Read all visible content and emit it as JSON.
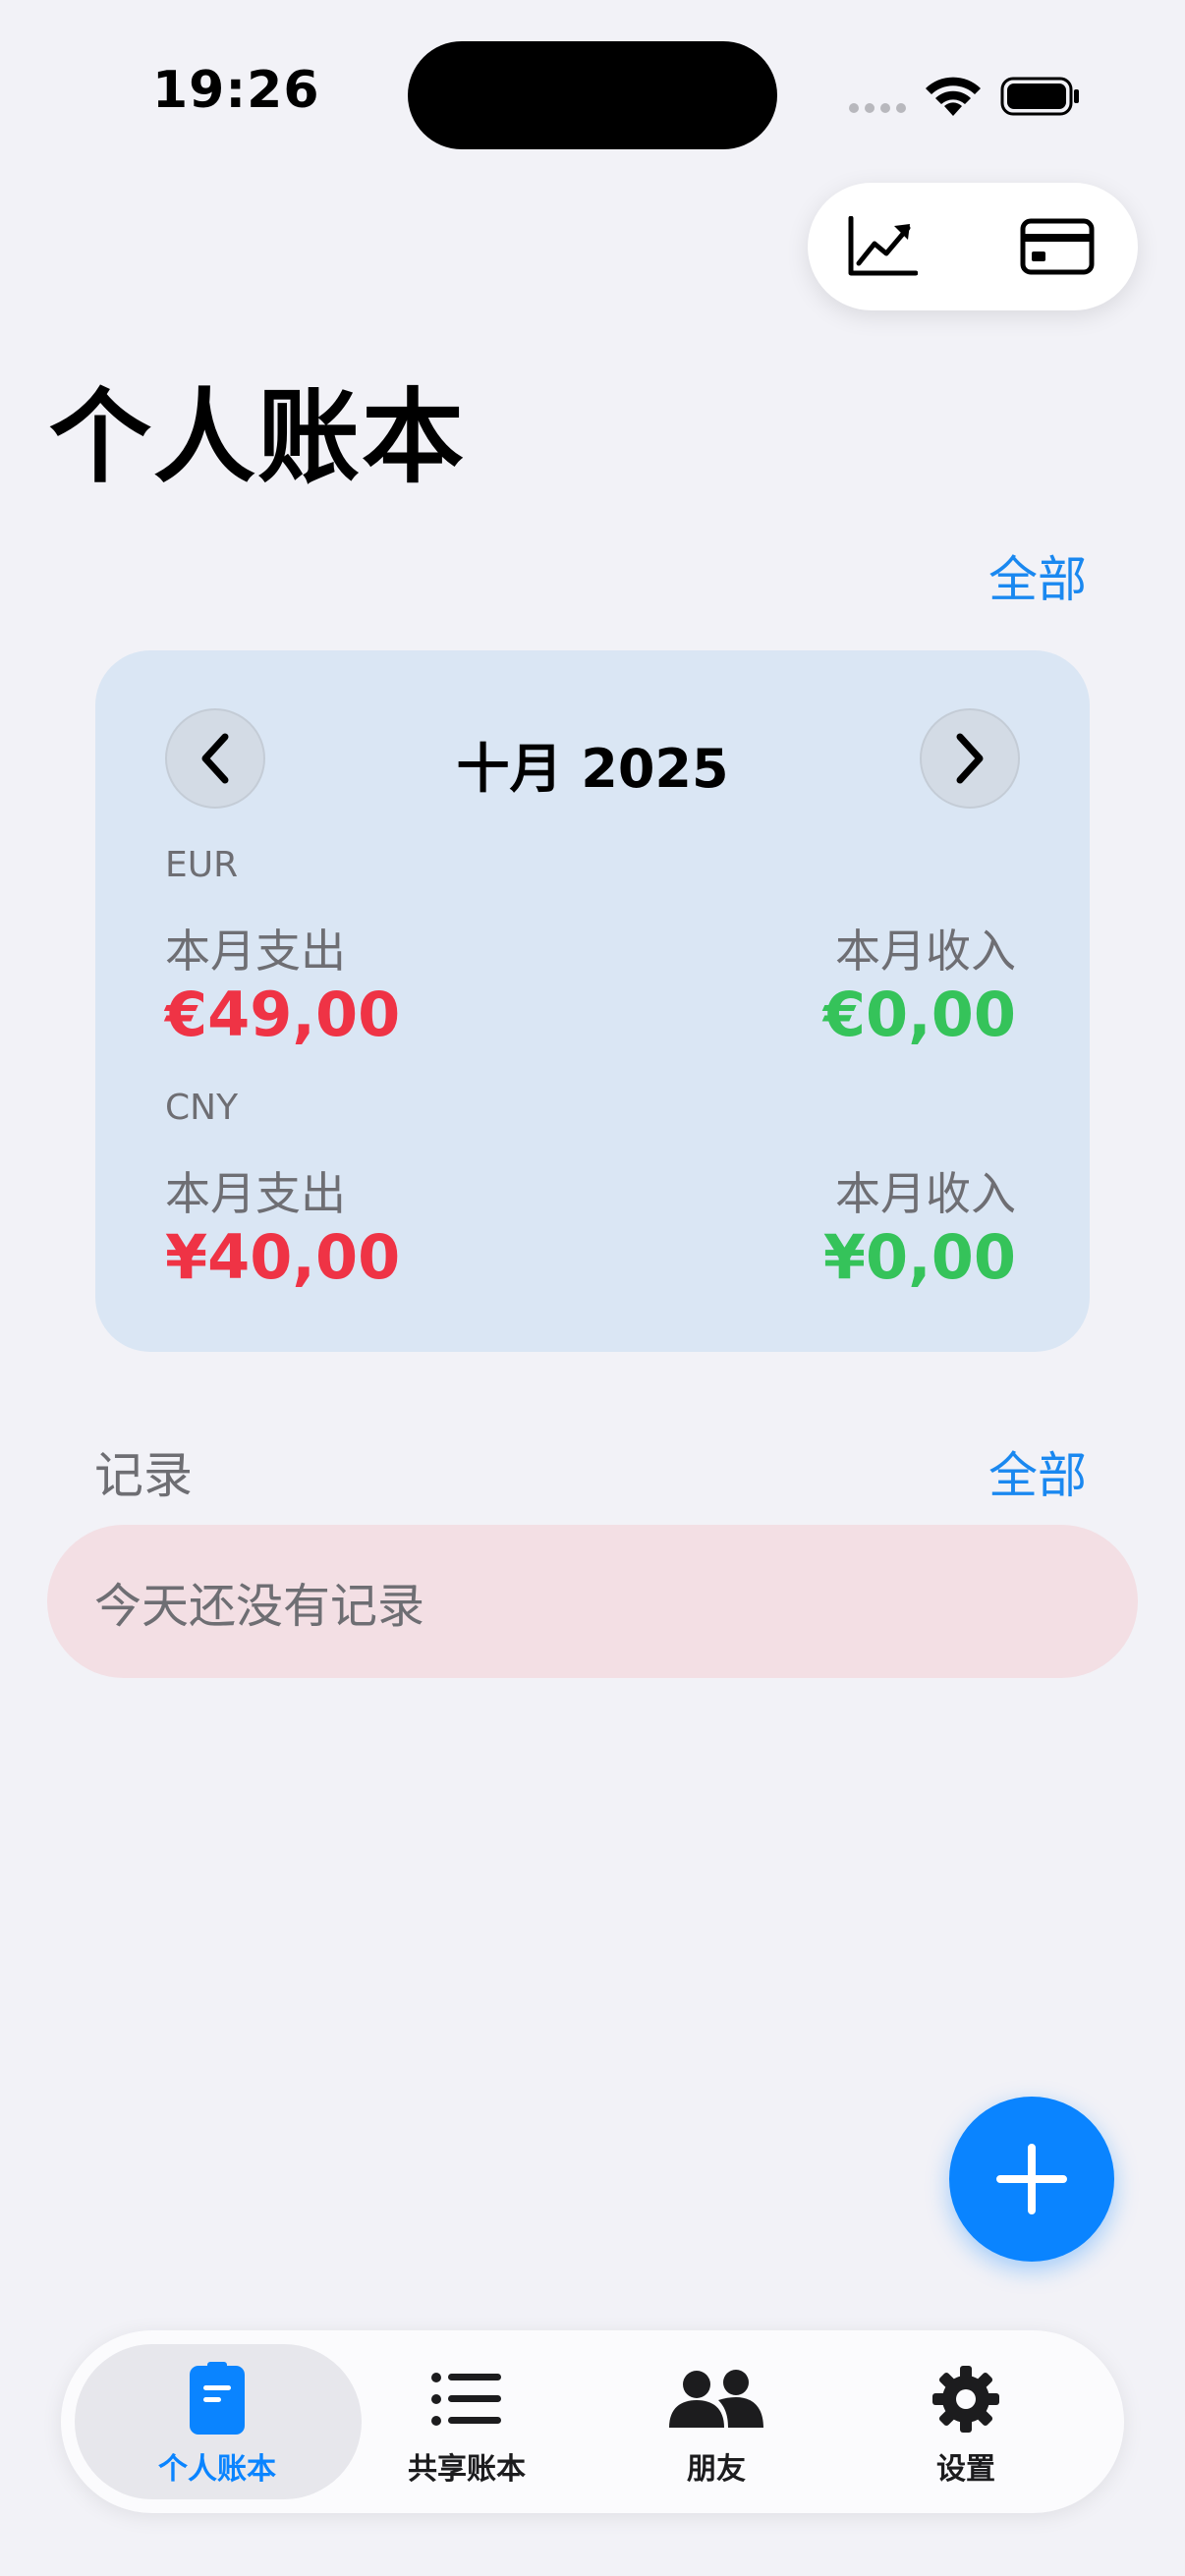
{
  "status_bar": {
    "time": "19:26"
  },
  "header": {
    "title": "个人账本"
  },
  "summary": {
    "all_link": "全部",
    "month": "十月 2025",
    "currencies": [
      {
        "code": "EUR",
        "expense_label": "本月支出",
        "expense": "€49,00",
        "income_label": "本月收入",
        "income": "€0,00"
      },
      {
        "code": "CNY",
        "expense_label": "本月支出",
        "expense": "¥40,00",
        "income_label": "本月收入",
        "income": "¥0,00"
      }
    ]
  },
  "records": {
    "section_label": "记录",
    "all_link": "全部",
    "empty_text": "今天还没有记录"
  },
  "tabs": [
    {
      "label": "个人账本",
      "icon": "ledger-icon",
      "active": true
    },
    {
      "label": "共享账本",
      "icon": "list-icon",
      "active": false
    },
    {
      "label": "朋友",
      "icon": "people-icon",
      "active": false
    },
    {
      "label": "设置",
      "icon": "gear-icon",
      "active": false
    }
  ],
  "colors": {
    "accent": "#0a84ff",
    "expense": "#ef3345",
    "income": "#35c35a",
    "card_bg": "#dae6f4",
    "empty_bg": "#f3dfe4"
  }
}
